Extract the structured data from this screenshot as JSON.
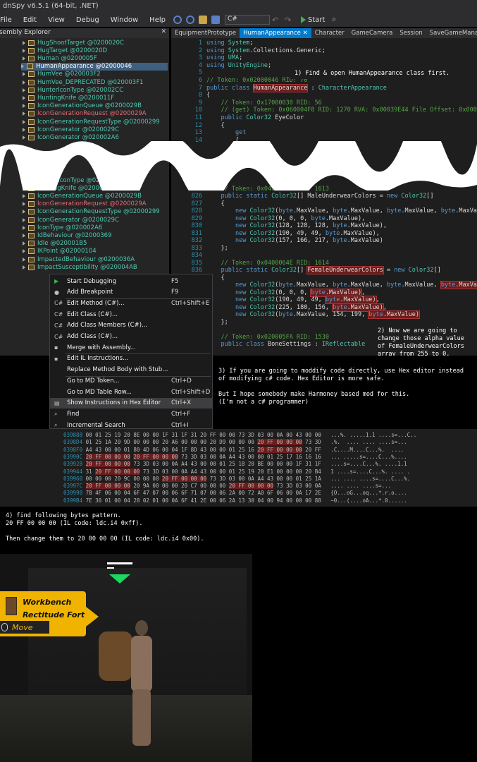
{
  "window": {
    "title": "dnSpy v6.5.1 (64-bit, .NET)"
  },
  "menu": [
    "File",
    "Edit",
    "View",
    "Debug",
    "Window",
    "Help"
  ],
  "toolbar": {
    "language": "C#",
    "start_label": "Start"
  },
  "assembly_explorer": {
    "title": "Assembly Explorer",
    "items_top": [
      "HugShootTarget @0200020C",
      "HugTarget @0200020D",
      "Human @0200005F",
      "HumanAppearance @02000046",
      "HumVee @020003F2",
      "HumVee_DEPRECATED @020003F1",
      "HunterIconType @020002CC",
      "HuntingKnife @0200011F",
      "IconGenerationQueue @0200029B",
      "IconGenerationRequest @0200029A",
      "IconGenerationRequestType @02000299",
      "IconGenerator @0200029C",
      "IconGenerator @020002A6"
    ],
    "items_bottom": [
      "HunterIconType @020002CC",
      "HuntingKnife @0200011F",
      "IconGenerationQueue @0200029B",
      "IconGenerationRequest @0200029A",
      "IconGenerationRequestType @02000299",
      "IconGenerator @0200029C",
      "IconType @020002A6",
      "IdBehaviour @02000369",
      "Idle @020001B5",
      "IKPoint @02000104",
      "ImpactedBehaviour @0200036A",
      "ImpactSusceptibility @020004AB"
    ]
  },
  "tabs": [
    "EquipmentPrototype",
    "HumanAppearance",
    "Character",
    "GameCamera",
    "Session",
    "SaveGameManager"
  ],
  "code_top": {
    "line_numbers": [
      "1",
      "2",
      "3",
      "4",
      "5",
      "6",
      "7",
      "8",
      "9",
      "10",
      "11",
      "12",
      "13",
      "14"
    ],
    "lines": [
      "using System;",
      "using System.Collections.Generic;",
      "using UMA;",
      "using UnityEngine;",
      "",
      "// Token: 0x02000046 RID: 70",
      "public class HumanAppearance : CharacterAppearance",
      "{",
      "    // Token: 0x17000038 RID: 56",
      "    // (get) Token: 0x060004F8 RID: 1270 RVA: 0x00039E44 File Offset: 0x00038044",
      "    public Color32 EyeColor",
      "    {",
      "        get",
      "        {"
    ]
  },
  "code_bottom": {
    "line_numbers": [
      "824",
      "825",
      "826",
      "827",
      "828",
      "829",
      "830",
      "831",
      "832",
      "833",
      "834",
      "835",
      "836",
      "837",
      "838",
      "839",
      "840",
      "841",
      "842",
      "843",
      "844",
      "845"
    ],
    "lines": [
      "",
      "    // Token: 0x0400064D RID: 1613",
      "    public static Color32[] MaleUnderwearColors = new Color32[]",
      "    {",
      "        new Color32(byte.MaxValue, byte.MaxValue, byte.MaxValue, byte.MaxValue),",
      "        new Color32(0, 0, 0, byte.MaxValue),",
      "        new Color32(128, 128, 128, byte.MaxValue),",
      "        new Color32(190, 49, 49, byte.MaxValue),",
      "        new Color32(157, 166, 217, byte.MaxValue)",
      "    };",
      "",
      "    // Token: 0x0400064E RID: 1614",
      "    public static Color32[] FemaleUnderwearColors = new Color32[]",
      "    {",
      "        new Color32(byte.MaxValue, byte.MaxValue, byte.MaxValue, byte.MaxValue),",
      "        new Color32(0, 0, 0, byte.MaxValue),",
      "        new Color32(190, 49, 49, byte.MaxValue),",
      "        new Color32(225, 180, 156, byte.MaxValue),",
      "        new Color32(byte.MaxValue, 154, 199, byte.MaxValue)",
      "    };",
      "",
      "    // Token: 0x020005FA RID: 1530",
      "    public class BoneSettings : IReflectable"
    ]
  },
  "notes": {
    "step1": "1) Find & open HumanAppearance class first.",
    "step2": "2) Now we are going to change those alpha value of FemaleUnderwearColors array from 255 to 0.",
    "step3": "3) If you are going to moddify code directly, use Hex editor instead of modifying c# code. Hex Editor is more safe.\n\nBut I hope somebody make Harmoney based mod for this.\n(I'm not a c# programmer)",
    "step4": "4) find following bytes pattern.\n20 FF 00 00 00 (IL code: ldc.i4 0xff).\n\nThen change them to 20 00 00 00 (IL code: ldc.i4 0x00)."
  },
  "context_menu": [
    {
      "label": "Start Debugging",
      "shortcut": "F5",
      "icon": "play-icon"
    },
    {
      "label": "Add Breakpoint",
      "shortcut": "F9",
      "icon": "breakpoint-icon"
    },
    {
      "label": "Edit Method (C#)...",
      "shortcut": "Ctrl+Shift+E",
      "icon": "csharp-icon"
    },
    {
      "label": "Edit Class (C#)...",
      "shortcut": "",
      "icon": "csharp-icon"
    },
    {
      "label": "Add Class Members (C#)...",
      "shortcut": "",
      "icon": "csharp-icon"
    },
    {
      "label": "Add Class (C#)...",
      "shortcut": "",
      "icon": "csharp-icon"
    },
    {
      "label": "Merge with Assembly...",
      "shortcut": "",
      "icon": "merge-icon"
    },
    {
      "label": "Edit IL Instructions...",
      "shortcut": "",
      "icon": "il-icon"
    },
    {
      "label": "Replace Method Body with Stub...",
      "shortcut": "",
      "icon": ""
    },
    {
      "label": "Go to MD Token...",
      "shortcut": "Ctrl+D",
      "icon": ""
    },
    {
      "label": "Go to MD Table Row...",
      "shortcut": "Ctrl+Shift+D",
      "icon": ""
    },
    {
      "label": "Show Instructions in Hex Editor",
      "shortcut": "Ctrl+X",
      "icon": "hex-icon"
    },
    {
      "label": "Find",
      "shortcut": "Ctrl+F",
      "icon": "search-icon"
    },
    {
      "label": "Incremental Search",
      "shortcut": "Ctrl+I",
      "icon": "search-icon"
    }
  ],
  "hex_rows": [
    "039888 00 01 25 19 20 8E 00 00 1F 31 1F 31 20 FF 00 00 73 3D 03 00 0A 00 43 00 00   ...%. .....1.1 ....s=...C..",
    "0398D4 01 25 1A 20 9D 00 00 00 20 A6 00 00 00 20 D9 00 00 00 20 FF 00 00 00 73 3D   .%.  .... .... ....s=...",
    "0398F0 A4 43 00 00 01 80 4D 06 00 04 1F 8D 43 00 00 01 25 16 20 FF 00 00 00 20 FF   .C....M....C...%.  ....",
    "03990C 20 FF 00 00 00 20 FF 00 00 00 73 3D 03 00 0A A4 43 00 00 01 25 17 16 16 16   ... .....s=....C...%....",
    "039928 20 FF 00 00 00 73 3D 03 00 0A A4 43 00 00 01 25 18 20 BE 00 00 00 1F 31 1F   ....s=....C...%. ....1.1",
    "039944 31 20 FF 00 00 00 73 3D 03 00 0A A4 43 00 00 01 25 19 20 E1 00 00 00 20 B4   1 ....s=....C...%. .... .",
    "039960 00 00 00 20 9C 00 00 00 20 FF 00 00 00 73 3D 03 00 0A A4 43 00 00 01 25 1A   ... .... ....s=....C...%.",
    "03997C 20 FF 00 00 00 20 9A 00 00 00 20 C7 00 00 00 20 FF 00 00 00 73 3D 03 00 0A   .... .... ....s=...",
    "039998 7B 4F 06 00 04 6F 47 07 00 06 6F 71 07 00 06 2A 00 72 A0 6F 06 00 0A 17 2E   {O...oG...oq...*.r.o....",
    "0399B4 7E 30 01 00 04 28 02 01 00 0A 6F 41 2E 00 06 2A 13 30 04 00 94 00 00 00 88   ~0...(....oA...*.0......"
  ],
  "game": {
    "workbench_title": "Workbench",
    "workbench_location": "Rectitude Fort",
    "move_label": "Move"
  },
  "colors": {
    "accent": "#007acc",
    "selection": "#3f5f7f",
    "highlight_red": "#a33333",
    "workbench_yellow": "#f0b400"
  }
}
